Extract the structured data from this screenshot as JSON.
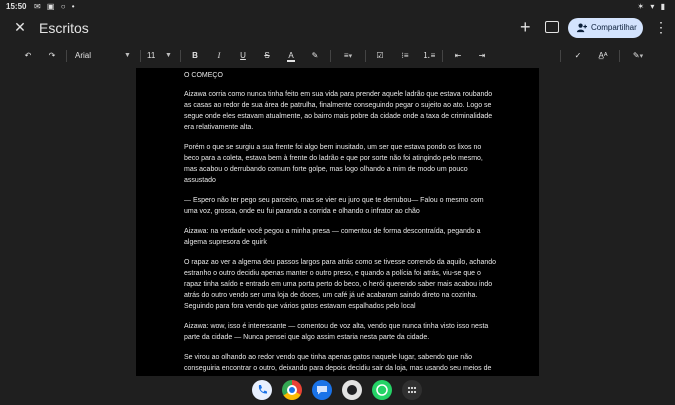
{
  "status_bar": {
    "time": "15:50",
    "left_icons": "✉ ▣ ○ •",
    "right_icons": "✶ ▾ ▮"
  },
  "app_bar": {
    "title": "Escritos",
    "share_label": "Compartilhar"
  },
  "toolbar": {
    "font": "Arial",
    "font_size": "11"
  },
  "document": {
    "paragraphs": [
      "O COMEÇO",
      "Aizawa corria como nunca tinha feito em sua vida para prender aquele ladrão que estava roubando as casas ao redor de sua área de patrulha, finalmente conseguindo pegar o sujeito ao ato. Logo se segue onde eles estavam atualmente, ao bairro mais pobre da cidade onde a taxa de criminalidade era relativamente alta.",
      "Porém  o que se surgiu a sua frente foi algo bem inusitado, um ser que estava pondo os lixos no beco para a coleta, estava bem à frente do ladrão e que por sorte não foi atingindo pelo mesmo, mas acabou o derrubando comum forte golpe, mas logo olhando a mim de modo um pouco assustado",
      "— Espero não ter pego seu parceiro, mas se vier eu juro que te derrubou— Falou o mesmo com uma voz, grossa, onde eu fui parando a corrida e olhando o infrator ao chão",
      "Aizawa: na verdade você pegou a minha presa — comentou de forma descontraída, pegando a algema supresora de quirk",
      "O rapaz ao ver a algema deu passos largos para atrás como se tivesse correndo da aquilo, achando estranho o outro decidiu apenas manter o outro preso, e quando a polícia foi atrás, viu-se que o rapaz tinha saído e entrado em uma porta perto do beco, o herói querendo saber mais acabou indo atrás do  outro vendo ser uma loja de doces, um café já ué acabaram saindo direto na cozinha. Seguindo para fora vendo que vários gatos estavam espalhados pelo local",
      "Aizawa: wow, isso é interessante — comentou de voz alta, vendo que nunca tinha visto isso nesta parte da cidade — Nunca pensei que algo assim estaria nesta parte da cidade.",
      "Se virou ao olhando ao redor vendo que tinha apenas gatos naquele lugar, sabendo que não conseguiria encontrar o outro, deixando para depois decidiu sair da loja, mas usando seu meios de herói, fechou a porta e se escondeu para ver se achava o outro, ma apenas"
    ]
  },
  "dock": {
    "apps": [
      "phone-app",
      "chrome-app",
      "messages-app",
      "camera-app",
      "whatsapp-app",
      "app-drawer"
    ]
  },
  "colors": {
    "background": "#1f1f1f",
    "page": "#000000",
    "share_button": "#d3e3fd",
    "text": "#e3e3e3"
  }
}
